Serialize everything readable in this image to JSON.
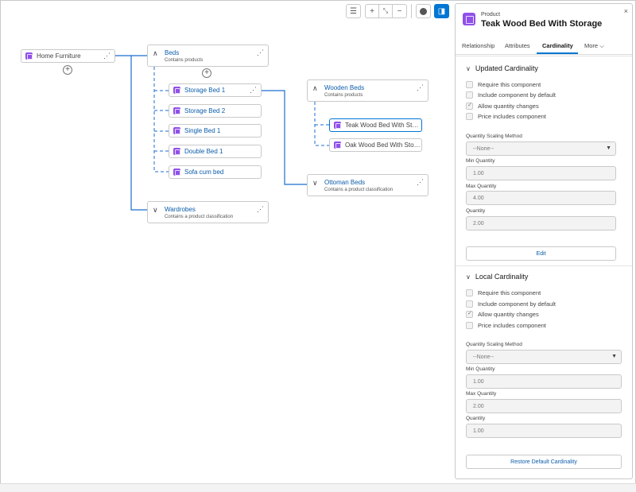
{
  "toolbar": {
    "list_icon": "☰",
    "zoom_in_icon": "+",
    "fit_icon": "⤡",
    "zoom_out_icon": "−",
    "minus_icon": "−",
    "panel_icon": "◨"
  },
  "tree": {
    "root": {
      "label": "Home Furniture",
      "add": "+"
    },
    "beds_group": {
      "title": "Beds",
      "subtitle": "Contains products",
      "add": "+"
    },
    "bed_items": [
      {
        "label": "Storage Bed 1"
      },
      {
        "label": "Storage Bed 2"
      },
      {
        "label": "Single Bed 1"
      },
      {
        "label": "Double Bed 1"
      },
      {
        "label": "Sofa cum bed"
      }
    ],
    "wooden_beds_group": {
      "title": "Wooden Beds",
      "subtitle": "Contains products"
    },
    "wooden_items": [
      {
        "label": "Teak Wood Bed With Stor..."
      },
      {
        "label": "Oak Wood Bed With Stora..."
      }
    ],
    "ottoman_group": {
      "title": "Ottoman Beds",
      "subtitle": "Contains a product classification"
    },
    "wardrobes_group": {
      "title": "Wardrobes",
      "subtitle": "Contains a product classification"
    }
  },
  "panel": {
    "type_label": "Product",
    "title": "Teak Wood Bed With Storage",
    "close": "×",
    "tabs": [
      "Relationship",
      "Attributes",
      "Cardinality",
      "More"
    ],
    "more_caret": "⌵",
    "updated": {
      "heading": "Updated Cardinality",
      "checkboxes": [
        {
          "label": "Require this component",
          "checked": false
        },
        {
          "label": "Include component by default",
          "checked": false
        },
        {
          "label": "Allow quantity changes",
          "checked": true
        },
        {
          "label": "Price includes component",
          "checked": false
        }
      ],
      "scaling_label": "Quantity Scaling Method",
      "scaling_value": "--None--",
      "min_label": "Min Quantity",
      "min_value": "1.00",
      "max_label": "Max Quantity",
      "max_value": "4.00",
      "qty_label": "Quantity",
      "qty_value": "2.00",
      "button": "Edit"
    },
    "local": {
      "heading": "Local Cardinality",
      "checkboxes": [
        {
          "label": "Require this component",
          "checked": false
        },
        {
          "label": "Include component by default",
          "checked": false
        },
        {
          "label": "Allow quantity changes",
          "checked": true
        },
        {
          "label": "Price includes component",
          "checked": false
        }
      ],
      "scaling_label": "Quantity Scaling Method",
      "scaling_value": "--None--",
      "min_label": "Min Quantity",
      "min_value": "1.00",
      "max_label": "Max Quantity",
      "max_value": "2.00",
      "qty_label": "Quantity",
      "qty_value": "1.00",
      "button": "Restore Default Cardinality"
    }
  },
  "colors": {
    "accent": "#0176d3",
    "product_icon": "#9050e9",
    "link": "#0b5cab"
  }
}
